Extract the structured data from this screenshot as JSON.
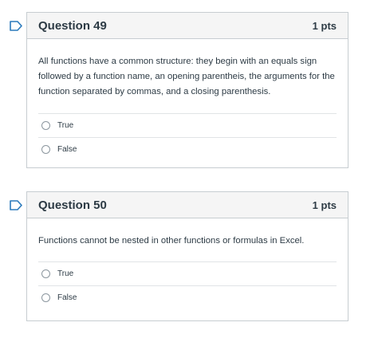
{
  "colors": {
    "flag_outline": "#2b7abc",
    "header_bg": "#f5f5f5",
    "border": "#c7cdd1",
    "text": "#2d3b45"
  },
  "questions": [
    {
      "title": "Question 49",
      "points": "1 pts",
      "flag_icon": "bookmark-flag-icon",
      "text": "All functions have a common structure: they begin with an equals sign followed by a function name, an opening parentheis, the arguments for the function separated by commas, and a closing parenthesis.",
      "answers": [
        {
          "label": "True",
          "selected": false
        },
        {
          "label": "False",
          "selected": false
        }
      ]
    },
    {
      "title": "Question 50",
      "points": "1 pts",
      "flag_icon": "bookmark-flag-icon",
      "text": "Functions cannot be nested in other functions or formulas in Excel.",
      "answers": [
        {
          "label": "True",
          "selected": false
        },
        {
          "label": "False",
          "selected": false
        }
      ]
    }
  ]
}
